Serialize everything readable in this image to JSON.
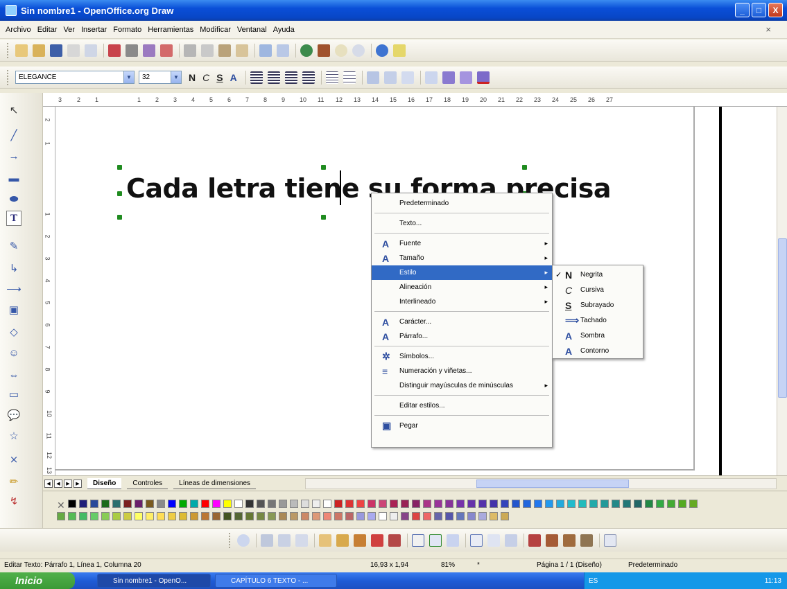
{
  "window": {
    "title": "Sin nombre1 - OpenOffice.org Draw",
    "btn_min": "_",
    "btn_max": "□",
    "btn_close": "X"
  },
  "menu": {
    "items": [
      "Archivo",
      "Editar",
      "Ver",
      "Insertar",
      "Formato",
      "Herramientas",
      "Modificar",
      "Ventanal",
      "Ayuda"
    ],
    "close": "×"
  },
  "format": {
    "font_name": "ELEGANCE",
    "font_size": "32",
    "bold": "N",
    "italic": "C",
    "underline": "S",
    "shadow": "A"
  },
  "ruler": {
    "h_ticks": [
      "3",
      "2",
      "1",
      "1",
      "2",
      "3",
      "4",
      "5",
      "6",
      "7",
      "8",
      "9",
      "10",
      "11",
      "12",
      "13",
      "14",
      "15",
      "16",
      "17",
      "18",
      "19",
      "20",
      "21",
      "22",
      "23",
      "24",
      "25",
      "26",
      "27"
    ],
    "v_ticks": [
      "2",
      "1",
      "1",
      "2",
      "3",
      "4",
      "5",
      "6",
      "7",
      "8",
      "9",
      "10",
      "11",
      "12",
      "13"
    ]
  },
  "document": {
    "text": "Cada letra tiene su forma precisa"
  },
  "tabs": [
    "Diseño",
    "Controles",
    "Líneas de dimensiones"
  ],
  "nav_glyphs": [
    "◀",
    "◀",
    "▶",
    "▶"
  ],
  "context_menu": {
    "items": [
      {
        "label": "Predeterminado",
        "icon": "",
        "submenu": false
      },
      {
        "sep": true
      },
      {
        "label": "Texto...",
        "icon": "",
        "submenu": false
      },
      {
        "sep": true
      },
      {
        "label": "Fuente",
        "icon": "A",
        "submenu": true
      },
      {
        "label": "Tamaño",
        "icon": "A",
        "submenu": true
      },
      {
        "label": "Estilo",
        "icon": "",
        "submenu": true,
        "highlight": true
      },
      {
        "label": "Alineación",
        "icon": "",
        "submenu": true
      },
      {
        "label": "Interlineado",
        "icon": "",
        "submenu": true
      },
      {
        "sep": true
      },
      {
        "label": "Carácter...",
        "icon": "A",
        "submenu": false
      },
      {
        "label": "Párrafo...",
        "icon": "A",
        "submenu": false
      },
      {
        "sep": true
      },
      {
        "label": "Símbolos...",
        "icon": "✲",
        "submenu": false
      },
      {
        "label": "Numeración y viñetas...",
        "icon": "≡",
        "submenu": false
      },
      {
        "label": "Distinguir mayúsculas de minúsculas",
        "icon": "",
        "submenu": true
      },
      {
        "sep": true
      },
      {
        "label": "Editar estilos...",
        "icon": "",
        "submenu": false
      },
      {
        "sep": true
      },
      {
        "label": "Pegar",
        "icon": "▣",
        "submenu": false
      }
    ]
  },
  "style_submenu": {
    "items": [
      {
        "label": "Negrita",
        "icon": "N",
        "checked": true
      },
      {
        "label": "Cursiva",
        "icon": "C",
        "checked": false
      },
      {
        "label": "Subrayado",
        "icon": "S",
        "checked": false
      },
      {
        "label": "Tachado",
        "icon": "⟹",
        "checked": false
      },
      {
        "label": "Sombra",
        "icon": "A",
        "checked": false
      },
      {
        "label": "Contorno",
        "icon": "A",
        "checked": false
      }
    ],
    "check": "✓"
  },
  "status": {
    "edit": "Editar Texto: Párrafo 1, Línea 1, Columna 20",
    "size": "16,93 x 1,94",
    "zoom": "81%",
    "star": "*",
    "page": "Página 1 / 1 (Diseño)",
    "style": "Predeterminado"
  },
  "taskbar": {
    "start": "Inicio",
    "task1": "Sin nombre1 - OpenO...",
    "task2": "CAPÍTULO 6 TEXTO - ...",
    "lang": "ES",
    "clock": "11:13"
  },
  "colors": {
    "titlebar": "#0a4fd8",
    "menu_highlight": "#316ac5",
    "selection_handle": "#1f8b1f",
    "taskbar": "#1f5cd6",
    "start": "#3b9a36"
  },
  "palette_row1": [
    "#000000",
    "#1f1f7a",
    "#2a4a9a",
    "#1b6a1b",
    "#2b6e6e",
    "#7a1f1f",
    "#6a1f6a",
    "#7a5a1f",
    "#8a8a8a",
    "#0000ff",
    "#00aa00",
    "#00aaaa",
    "#ff0000",
    "#ff00ff",
    "#ffff00",
    "#ffffff",
    "#333333",
    "#555555",
    "#777777",
    "#999999",
    "#bbbbbb",
    "#dddddd",
    "#eeeeee",
    "#ffffff",
    "#cc2222",
    "#dd3333",
    "#ee4444",
    "#cc3366",
    "#cc4477",
    "#aa2255",
    "#992255",
    "#882266",
    "#aa3388",
    "#993399",
    "#883399",
    "#7733aa",
    "#6633aa",
    "#5533aa",
    "#4433aa",
    "#3344bb",
    "#2255cc",
    "#2266dd",
    "#2277ee",
    "#2299ee",
    "#22aadd",
    "#22bbcc",
    "#22bbbb",
    "#22aaaa",
    "#229999",
    "#228888",
    "#227777",
    "#226666",
    "#228844",
    "#33aa44",
    "#44aa33",
    "#55aa22",
    "#66aa22"
  ],
  "palette_row2": [
    "#66aa44",
    "#55bb55",
    "#44bb66",
    "#66cc66",
    "#88cc55",
    "#aacc44",
    "#cccc44",
    "#ffff66",
    "#ffee66",
    "#ffdd55",
    "#eecc44",
    "#ddbb33",
    "#cc9933",
    "#bb7733",
    "#996633",
    "#445522",
    "#556633",
    "#667733",
    "#778844",
    "#889955",
    "#aa8855",
    "#bb9966",
    "#cc8866",
    "#dd9977",
    "#ee8877",
    "#cc7766",
    "#bb6666",
    "#9999dd",
    "#aaaaee",
    "#ffffff",
    "#eeeeee",
    "#884488",
    "#dd4444",
    "#ee6666",
    "#6666aa",
    "#5555aa",
    "#6677bb",
    "#8888cc",
    "#aaaadd",
    "#ddbb66",
    "#ccaa55"
  ]
}
